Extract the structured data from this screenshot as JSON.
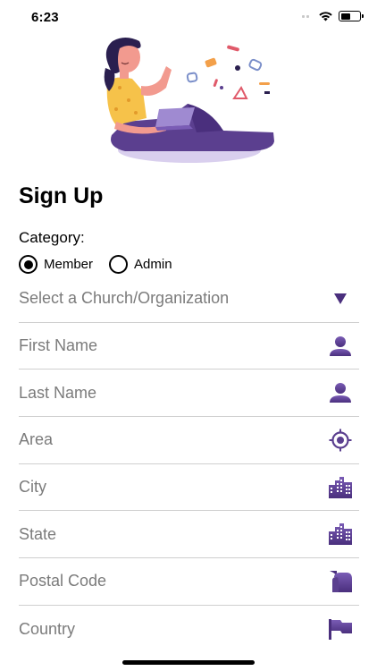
{
  "status_bar": {
    "time": "6:23",
    "battery_level": 0.5
  },
  "page": {
    "title": "Sign Up"
  },
  "category": {
    "label": "Category:",
    "options": [
      {
        "label": "Member",
        "selected": true
      },
      {
        "label": "Admin",
        "selected": false
      }
    ]
  },
  "form": {
    "church_select": {
      "placeholder": "Select a Church/Organization",
      "icon": "dropdown-triangle-icon"
    },
    "first_name": {
      "placeholder": "First Name",
      "icon": "person-icon"
    },
    "last_name": {
      "placeholder": "Last Name",
      "icon": "person-icon"
    },
    "area": {
      "placeholder": "Area",
      "icon": "location-target-icon"
    },
    "city": {
      "placeholder": "City",
      "icon": "city-buildings-icon"
    },
    "state": {
      "placeholder": "State",
      "icon": "city-buildings-icon"
    },
    "postal_code": {
      "placeholder": "Postal Code",
      "icon": "mailbox-icon"
    },
    "country": {
      "placeholder": "Country",
      "icon": "flag-icon"
    }
  },
  "colors": {
    "icon_purple": "#5b3f8f",
    "icon_purple_light": "#7a5cb5",
    "text_gray": "#7b7b7b",
    "divider": "#cfcfcf"
  }
}
